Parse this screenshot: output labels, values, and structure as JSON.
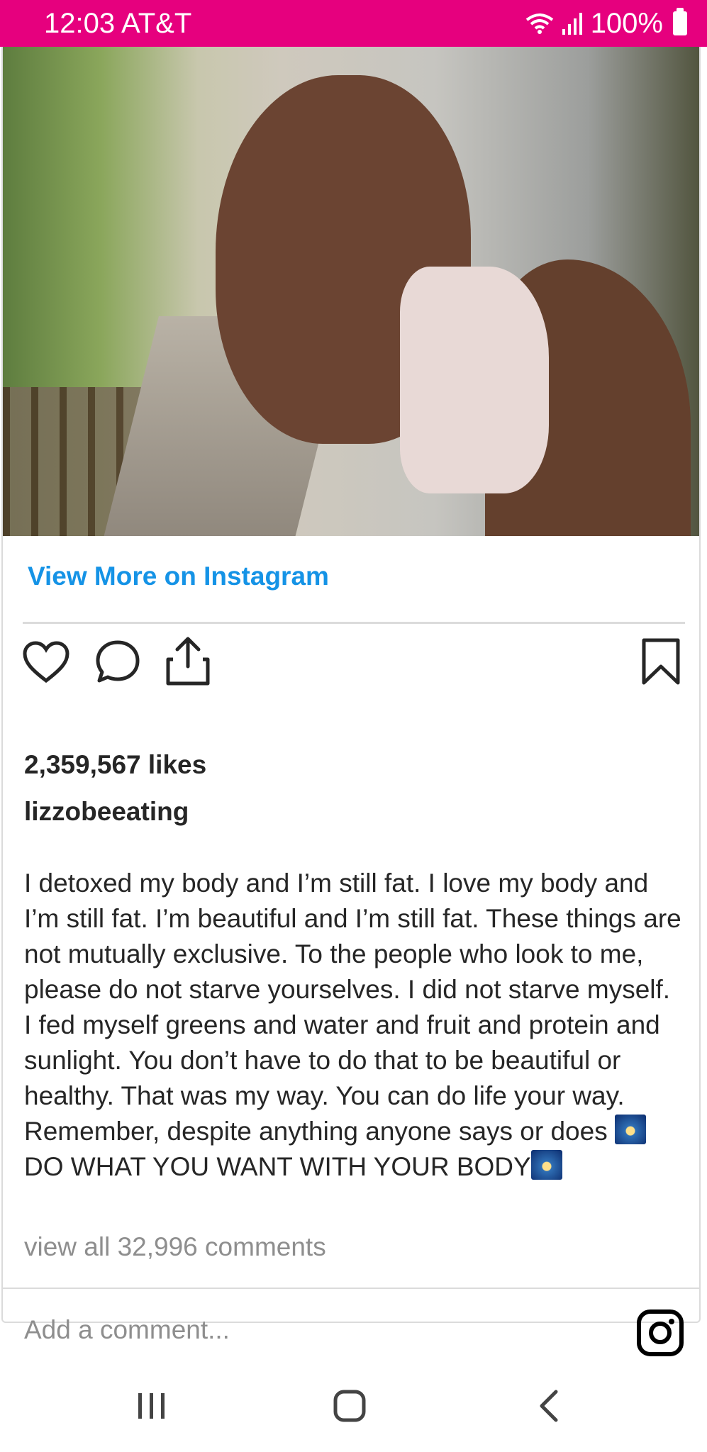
{
  "status_bar": {
    "time": "12:03",
    "carrier": "AT&T",
    "battery": "100%"
  },
  "post": {
    "view_more_label": "View More on Instagram",
    "likes": "2,359,567 likes",
    "username": "lizzobeeating",
    "caption_text": "I detoxed my body and I’m still fat. I love my body and I’m still fat. I’m beautiful and I’m still fat. These things are not mutually exclusive. To the people who look to me, please do not starve yourselves. I did not starve myself. I fed myself greens and water and fruit and protein and sunlight. You don’t have to do that to be beautiful or healthy. That was my way. You can do life your way. Remember, despite anything anyone says or does ",
    "caption_text_2": "DO WHAT YOU WANT WITH YOUR BODY",
    "view_comments": "view all 32,996 comments"
  },
  "comment": {
    "placeholder": "Add a comment..."
  },
  "icons": {
    "like": "heart-icon",
    "comment": "comment-bubble-icon",
    "share": "share-icon",
    "save": "bookmark-icon",
    "instagram": "instagram-logo-icon",
    "emoji": "fireworks-emoji-icon"
  },
  "colors": {
    "status_bar": "#e6007e",
    "link": "#1593e6",
    "muted": "#8e8e8e"
  }
}
